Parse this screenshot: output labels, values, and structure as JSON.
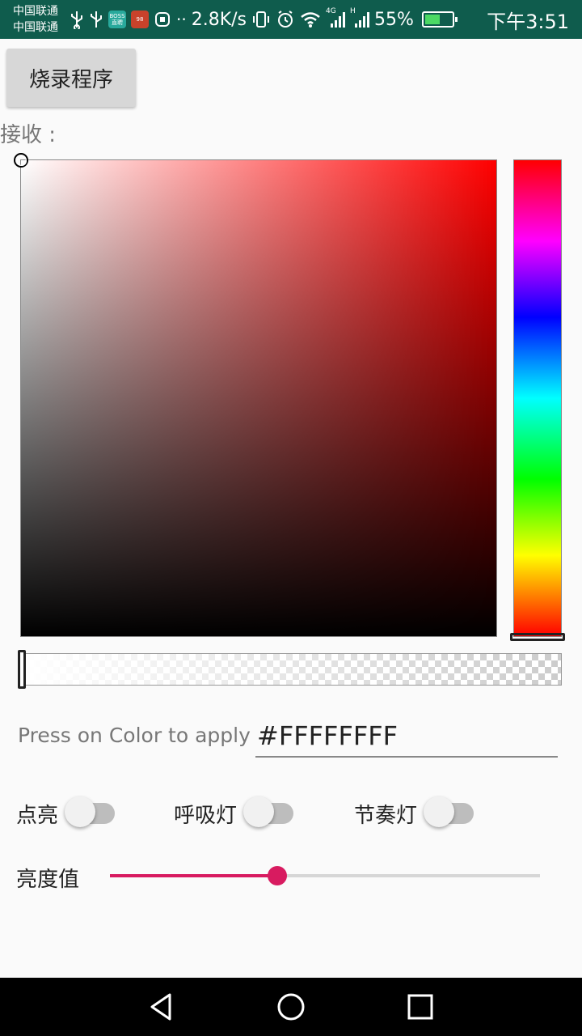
{
  "status_bar": {
    "carrier_1": "中国联通",
    "carrier_2": "中国联通",
    "app_badge_1": "BOSS 直聘",
    "app_badge_2": "98",
    "speed": "2.8K/s",
    "network_4g": "4G",
    "network_h": "H",
    "battery": "55%",
    "battery_level": 0.55,
    "time": "下午3:51"
  },
  "toolbar": {
    "burn_label": "烧录程序"
  },
  "receive": {
    "label": "接收 :"
  },
  "color_picker": {
    "hue_color": "#ff0000",
    "press_label": "Press on Color to apply",
    "hex_value": "#FFFFFFFF"
  },
  "switches": [
    {
      "label": "点亮",
      "on": false
    },
    {
      "label": "呼吸灯",
      "on": false
    },
    {
      "label": "节奏灯",
      "on": false
    }
  ],
  "brightness": {
    "label": "亮度值",
    "value": 0.39,
    "accent": "#d81b60"
  }
}
